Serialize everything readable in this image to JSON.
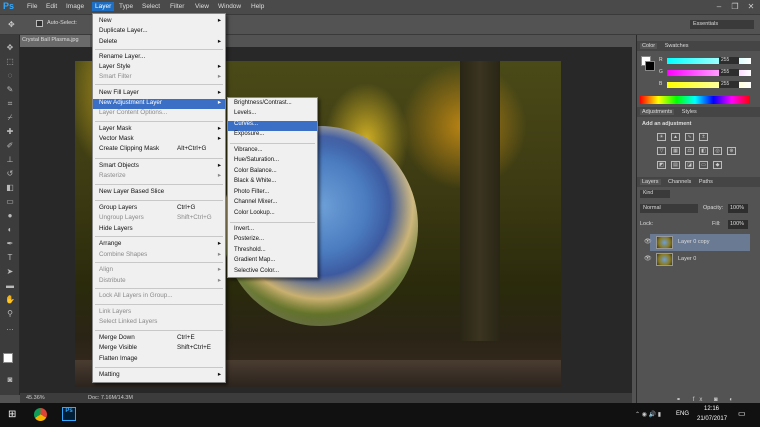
{
  "menubar": {
    "logo": "Ps",
    "items": [
      "File",
      "Edit",
      "Image",
      "Layer",
      "Type",
      "Select",
      "Filter",
      "View",
      "Window",
      "Help"
    ],
    "active": "Layer"
  },
  "options": {
    "auto_select": "Auto-Select:",
    "workspace": "Essentials"
  },
  "document": {
    "tab": "Crystal Ball Plasma.jpg",
    "zoom": "45.36%",
    "doc_info": "Doc: 7.16M/14.3M"
  },
  "layer_menu": {
    "items": [
      {
        "label": "New",
        "arrow": true
      },
      {
        "label": "Duplicate Layer...",
        "shortcut": ""
      },
      {
        "label": "Delete",
        "arrow": true
      },
      {
        "label": "Rename Layer..."
      },
      {
        "label": "Layer Style",
        "arrow": true
      },
      {
        "label": "Smart Filter",
        "arrow": true,
        "disabled": true
      },
      {
        "label": "New Fill Layer",
        "arrow": true
      },
      {
        "label": "New Adjustment Layer",
        "arrow": true,
        "highlight": true
      },
      {
        "label": "Layer Content Options...",
        "disabled": true
      },
      {
        "label": "Layer Mask",
        "arrow": true
      },
      {
        "label": "Vector Mask",
        "arrow": true
      },
      {
        "label": "Create Clipping Mask",
        "shortcut": "Alt+Ctrl+G"
      },
      {
        "label": "Smart Objects",
        "arrow": true
      },
      {
        "label": "Rasterize",
        "arrow": true,
        "disabled": true
      },
      {
        "label": "New Layer Based Slice"
      },
      {
        "label": "Group Layers",
        "shortcut": "Ctrl+G"
      },
      {
        "label": "Ungroup Layers",
        "shortcut": "Shift+Ctrl+G",
        "disabled": true
      },
      {
        "label": "Hide Layers"
      },
      {
        "label": "Arrange",
        "arrow": true
      },
      {
        "label": "Combine Shapes",
        "arrow": true,
        "disabled": true
      },
      {
        "label": "Align",
        "arrow": true,
        "disabled": true
      },
      {
        "label": "Distribute",
        "arrow": true,
        "disabled": true
      },
      {
        "label": "Lock All Layers in Group...",
        "disabled": true
      },
      {
        "label": "Link Layers",
        "disabled": true
      },
      {
        "label": "Select Linked Layers",
        "disabled": true
      },
      {
        "label": "Merge Down",
        "shortcut": "Ctrl+E"
      },
      {
        "label": "Merge Visible",
        "shortcut": "Shift+Ctrl+E"
      },
      {
        "label": "Flatten Image"
      },
      {
        "label": "Matting",
        "arrow": true
      }
    ]
  },
  "adjustment_submenu": {
    "items": [
      {
        "label": "Brightness/Contrast..."
      },
      {
        "label": "Levels..."
      },
      {
        "label": "Curves...",
        "highlight": true
      },
      {
        "label": "Exposure..."
      },
      {
        "label": "Vibrance..."
      },
      {
        "label": "Hue/Saturation..."
      },
      {
        "label": "Color Balance..."
      },
      {
        "label": "Black & White..."
      },
      {
        "label": "Photo Filter..."
      },
      {
        "label": "Channel Mixer..."
      },
      {
        "label": "Color Lookup..."
      },
      {
        "label": "Invert..."
      },
      {
        "label": "Posterize..."
      },
      {
        "label": "Threshold..."
      },
      {
        "label": "Gradient Map..."
      },
      {
        "label": "Selective Color..."
      }
    ]
  },
  "color_panel": {
    "tabs": [
      "Color",
      "Swatches"
    ],
    "channels": [
      {
        "name": "R",
        "value": "255"
      },
      {
        "name": "G",
        "value": "255"
      },
      {
        "name": "B",
        "value": "255"
      }
    ]
  },
  "adjustments_panel": {
    "tabs": [
      "Adjustments",
      "Styles"
    ],
    "hint": "Add an adjustment"
  },
  "layers_panel": {
    "tabs": [
      "Layers",
      "Channels",
      "Paths"
    ],
    "kind": "Kind",
    "blend": "Normal",
    "opacity_label": "Opacity:",
    "opacity": "100%",
    "lock_label": "Lock:",
    "fill_label": "Fill:",
    "fill": "100%",
    "layers": [
      {
        "name": "Layer 0 copy",
        "selected": true
      },
      {
        "name": "Layer 0",
        "selected": false
      }
    ]
  },
  "taskbar": {
    "time": "12:16",
    "date": "21/07/2017",
    "lang": "ENG"
  },
  "colors": {
    "accent": "#3b6fc5",
    "ps_blue": "#31a8ff"
  }
}
